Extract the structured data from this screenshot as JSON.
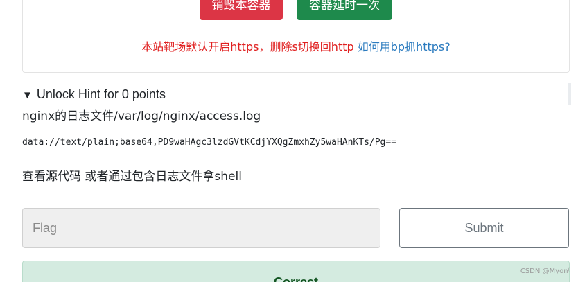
{
  "container": {
    "destroy_label": "销毁本容器",
    "extend_label": "容器延时一次",
    "https_warning": "本站靶场默认开启https，删除s切换回http",
    "https_link": "如何用bp抓https?"
  },
  "hint": {
    "toggle_icon": "▼",
    "toggle_label": "Unlock Hint for 0 points",
    "lines": [
      "nginx的日志文件/var/log/nginx/access.log",
      "data://text/plain;base64,PD9waHAgc3lzdGVtKCdjYXQgZmxhZy5waHAnKTs/Pg==",
      "查看源代码 或者通过包含日志文件拿shell"
    ]
  },
  "form": {
    "flag_placeholder": "Flag",
    "flag_value": "",
    "submit_label": "Submit"
  },
  "result": {
    "status_text": "Correct"
  },
  "watermark": "CSDN @Myon⁽"
}
